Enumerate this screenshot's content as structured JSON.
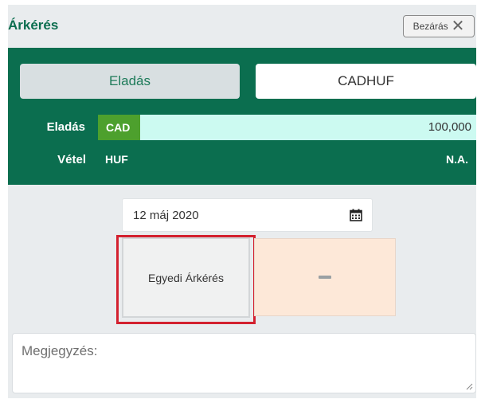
{
  "header": {
    "title": "Árkérés",
    "close_label": "Bezárás"
  },
  "tabs": {
    "sell_label": "Eladás",
    "pair": "CADHUF"
  },
  "sell_row": {
    "label": "Eladás",
    "currency": "CAD",
    "amount": "100,000"
  },
  "buy_row": {
    "label": "Vétel",
    "currency": "HUF",
    "rate": "N.A."
  },
  "date": {
    "value": "12 máj 2020"
  },
  "quote": {
    "button_label": "Egyedi Árkérés"
  },
  "note": {
    "placeholder": "Megjegyzés:"
  },
  "colors": {
    "brand_green": "#0b6e4f",
    "badge_green": "#4da02d",
    "amount_bg": "#ccfaf1",
    "result_bg": "#fde8d8",
    "highlight_red": "#d3212f"
  },
  "icons": [
    "close-icon",
    "calendar-icon",
    "dash-icon",
    "resize-handle-icon"
  ]
}
